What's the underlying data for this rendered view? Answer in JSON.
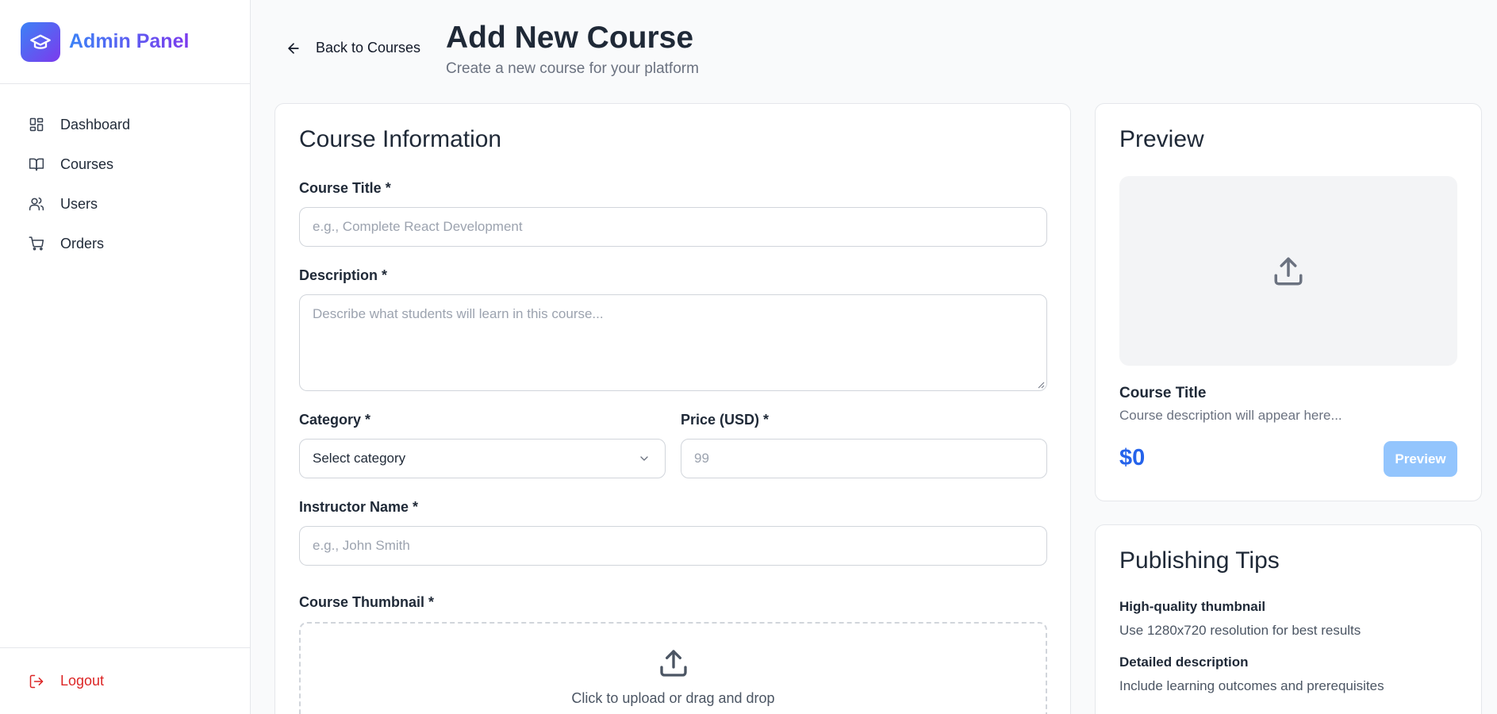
{
  "sidebar": {
    "brand": "Admin Panel",
    "items": [
      {
        "label": "Dashboard",
        "icon": "dashboard-icon"
      },
      {
        "label": "Courses",
        "icon": "book-icon"
      },
      {
        "label": "Users",
        "icon": "users-icon"
      },
      {
        "label": "Orders",
        "icon": "cart-icon"
      }
    ],
    "logout": "Logout"
  },
  "header": {
    "back": "Back to Courses",
    "title": "Add New Course",
    "subtitle": "Create a new course for your platform"
  },
  "form": {
    "section_title": "Course Information",
    "course_title_label": "Course Title *",
    "course_title_placeholder": "e.g., Complete React Development",
    "description_label": "Description *",
    "description_placeholder": "Describe what students will learn in this course...",
    "category_label": "Category *",
    "category_value": "Select category",
    "price_label": "Price (USD) *",
    "price_placeholder": "99",
    "instructor_label": "Instructor Name *",
    "instructor_placeholder": "e.g., John Smith",
    "thumbnail_label": "Course Thumbnail *",
    "upload_text": "Click to upload or drag and drop"
  },
  "preview": {
    "title": "Preview",
    "course_title": "Course Title",
    "course_desc": "Course description will appear here...",
    "price": "$0",
    "button": "Preview"
  },
  "tips": {
    "title": "Publishing Tips",
    "items": [
      {
        "title": "High-quality thumbnail",
        "text": "Use 1280x720 resolution for best results"
      },
      {
        "title": "Detailed description",
        "text": "Include learning outcomes and prerequisites"
      }
    ]
  },
  "colors": {
    "accent": "#3b82f6",
    "brand_gradient_end": "#7c3aed",
    "logout": "#dc2626",
    "price": "#2563eb",
    "preview_button": "#93c5fd"
  }
}
